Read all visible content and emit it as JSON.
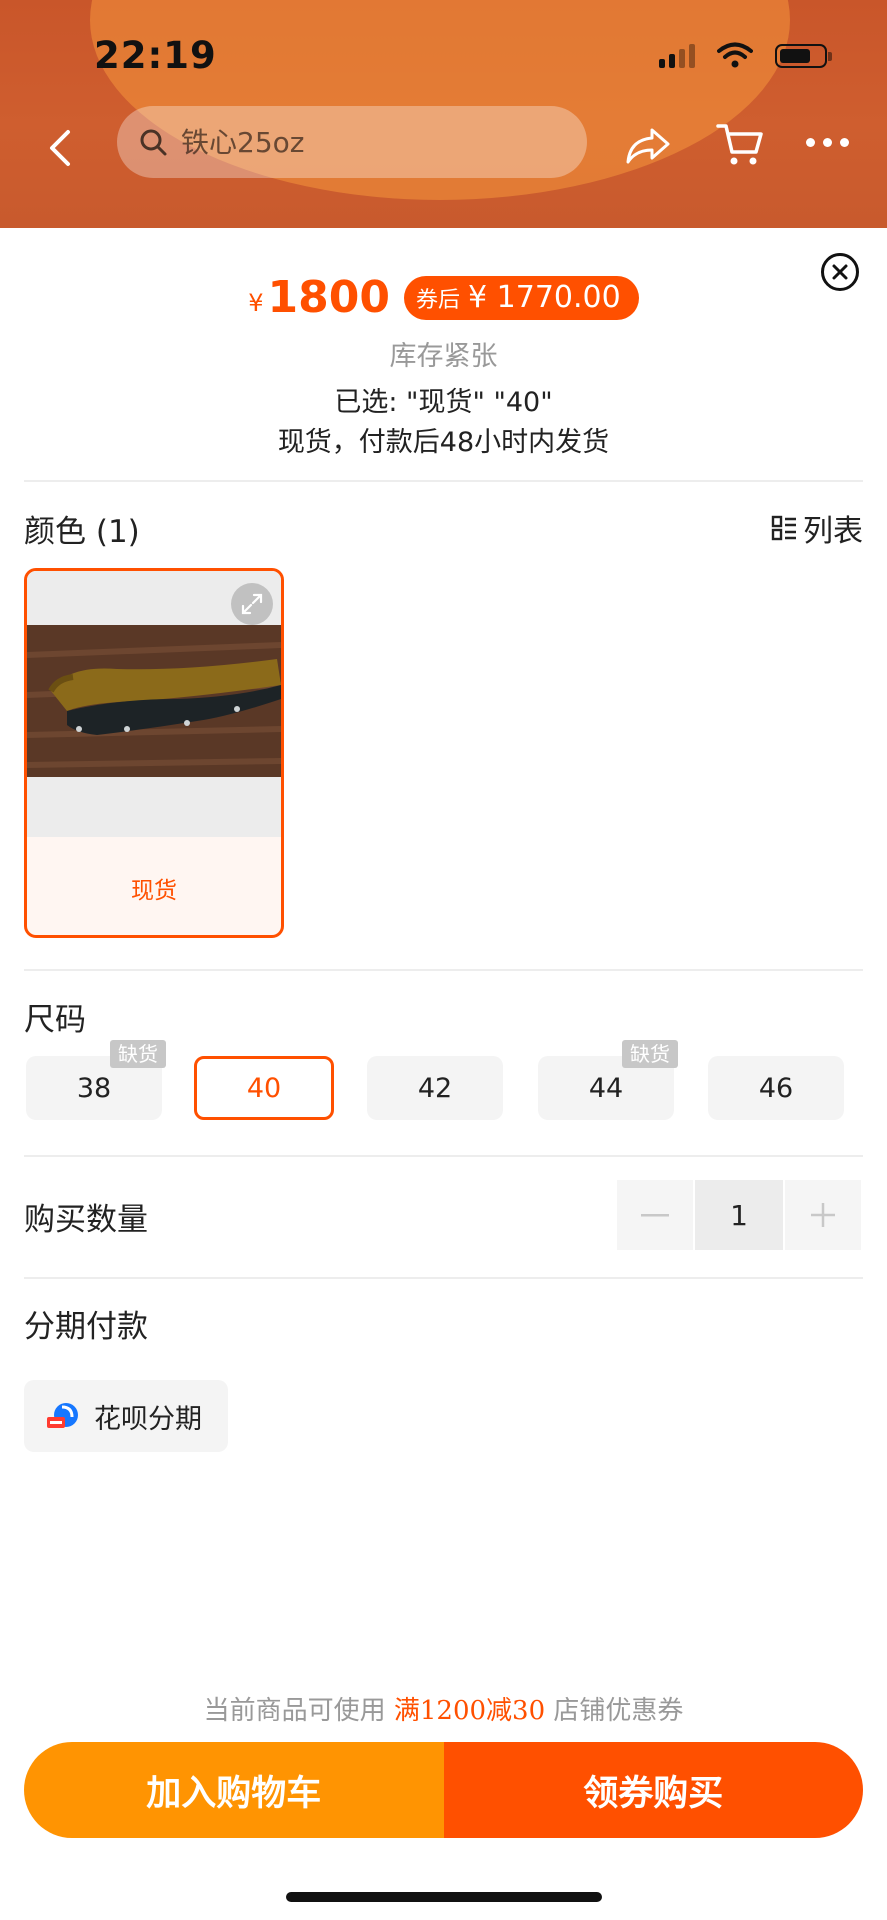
{
  "status_bar": {
    "time": "22:19"
  },
  "header": {
    "search_placeholder": "铁心25oz"
  },
  "sheet": {
    "price_symbol": "¥",
    "price": "1800",
    "coupon_tag": "券后",
    "coupon_price": "¥ 1770.00",
    "stock_status": "库存紧张",
    "selected": "已选: \"现货\" \"40\"",
    "shipping": "现货，付款后48小时内发货",
    "color_section_title": "颜色 (1)",
    "list_view_label": "列表",
    "color_options": [
      {
        "label": "现货",
        "selected": true
      }
    ],
    "size_section_title": "尺码",
    "sizes": [
      {
        "label": "38",
        "badge": "缺货",
        "selected": false
      },
      {
        "label": "40",
        "badge": "",
        "selected": true
      },
      {
        "label": "42",
        "badge": "",
        "selected": false
      },
      {
        "label": "44",
        "badge": "缺货",
        "selected": false
      },
      {
        "label": "46",
        "badge": "",
        "selected": false
      }
    ],
    "quantity_label": "购买数量",
    "quantity": "1",
    "installment_title": "分期付款",
    "installment_option": "花呗分期",
    "coupon_note_prefix": "当前商品可使用",
    "coupon_note_highlight": "满1200减30",
    "coupon_note_suffix": "店铺优惠券",
    "add_to_cart_label": "加入购物车",
    "buy_label": "领券购买"
  },
  "colors": {
    "accent": "#ff5000",
    "cart_button": "#ff9402",
    "badge_gray": "#c7c7c7"
  }
}
